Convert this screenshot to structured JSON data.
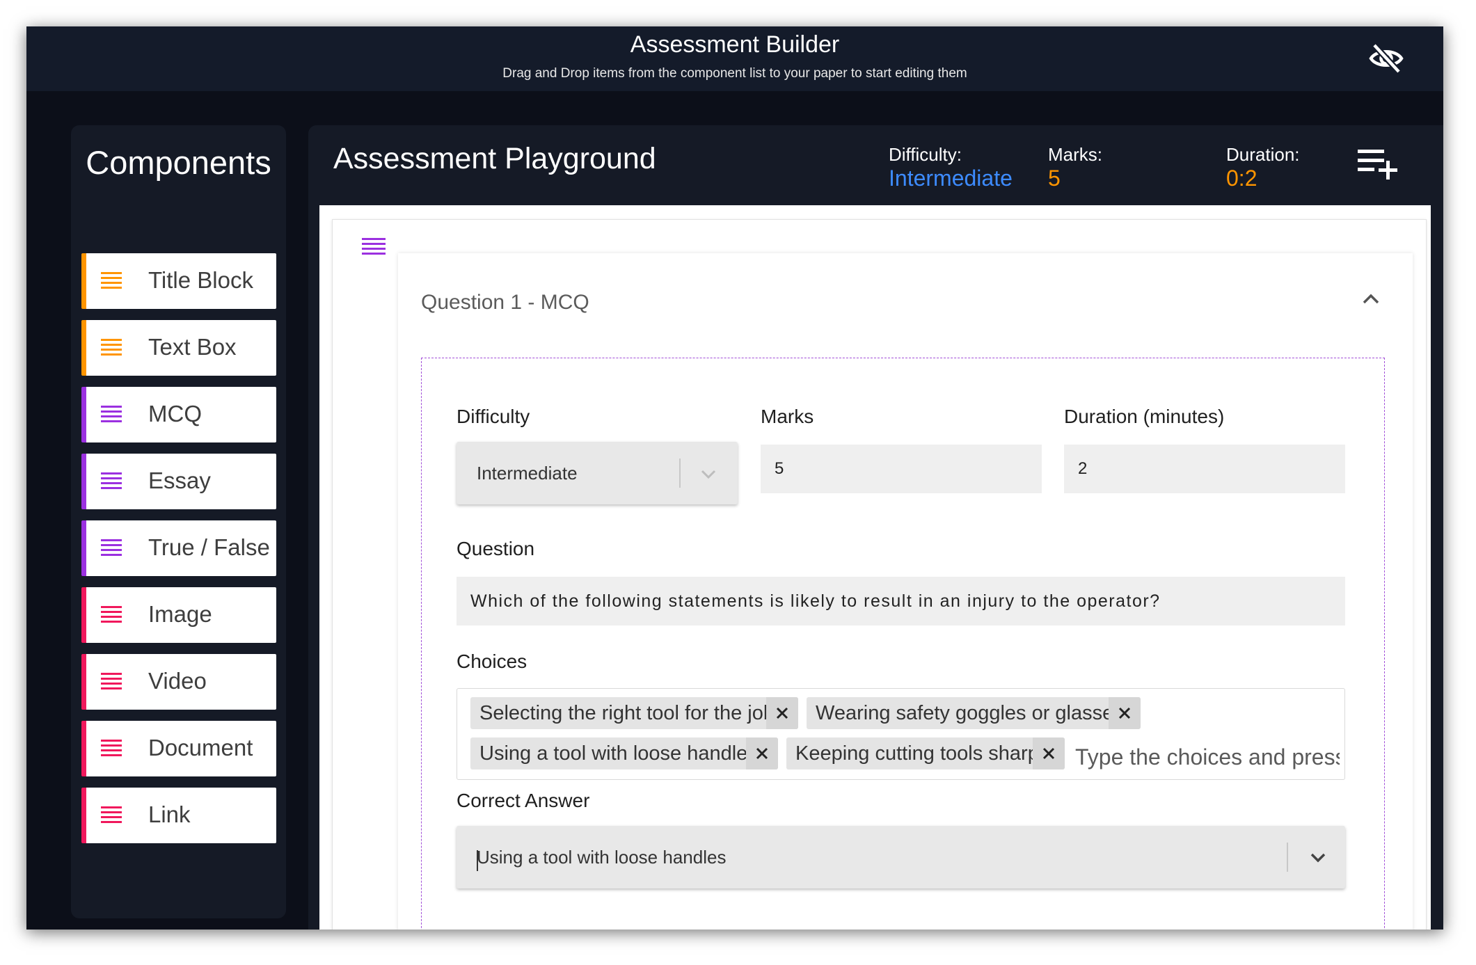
{
  "header": {
    "title": "Assessment Builder",
    "subtitle": "Drag and Drop items from the component list to your paper to start editing them",
    "visibility_toggle_icon": "eye-off-icon"
  },
  "sidebar": {
    "title": "Components",
    "items": [
      {
        "label": "Title Block",
        "color": "#ff9500",
        "icon": "list-icon"
      },
      {
        "label": "Text Box",
        "color": "#ff9500",
        "icon": "list-icon"
      },
      {
        "label": "MCQ",
        "color": "#9b30e0",
        "icon": "list-icon"
      },
      {
        "label": "Essay",
        "color": "#9b30e0",
        "icon": "list-icon"
      },
      {
        "label": "True / False",
        "color": "#9b30e0",
        "icon": "list-icon"
      },
      {
        "label": "Image",
        "color": "#f0185c",
        "icon": "list-icon"
      },
      {
        "label": "Video",
        "color": "#f0185c",
        "icon": "list-icon"
      },
      {
        "label": "Document",
        "color": "#f0185c",
        "icon": "list-icon"
      },
      {
        "label": "Link",
        "color": "#f0185c",
        "icon": "list-icon"
      }
    ]
  },
  "playground": {
    "title": "Assessment Playground",
    "difficulty_label": "Difficulty:",
    "difficulty_value": "Intermediate",
    "marks_label": "Marks:",
    "marks_value": "5",
    "duration_label": "Duration:",
    "duration_value": "0:2",
    "add_icon": "playlist-add-icon",
    "colors": {
      "difficulty": "#3d8bff",
      "marks": "#ff9500",
      "duration": "#ff9500"
    }
  },
  "question": {
    "header": "Question 1 - MCQ",
    "collapse_icon": "chevron-up-icon",
    "difficulty_label": "Difficulty",
    "difficulty_value": "Intermediate",
    "marks_label": "Marks",
    "marks_value": "5",
    "duration_label": "Duration (minutes)",
    "duration_value": "2",
    "question_label": "Question",
    "question_value": "Which of the following statements is likely to result in an injury to the operator?",
    "choices_label": "Choices",
    "choices": [
      "Selecting the right tool for the job",
      "Wearing safety goggles or glasses",
      "Using a tool with loose handles",
      "Keeping cutting tools sharp"
    ],
    "choices_placeholder": "Type the choices and press enter",
    "correct_answer_label": "Correct Answer",
    "correct_answer_value": "Using a tool with loose handles"
  }
}
